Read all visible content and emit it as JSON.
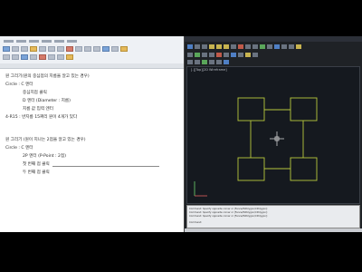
{
  "document": {
    "lines": [
      "원 그리기(원의 중심점의 지름을 알고 있는 경우)",
      "Circle : C 엔터",
      "중심지점 클릭",
      "D 엔터 (Diameter : 지름)",
      "지름 값 입력 엔터",
      "4-R15 : 반지름 15짜리 원이 4개가 있다",
      "원 그리기 (원이 지나는 2점을 알고 있는 경우)",
      "Circle : C 엔터",
      "2P 엔터 (P-Point : 2점)",
      "첫 번째 점 클릭",
      "두 번째 점 클릭"
    ]
  },
  "cad": {
    "viewport_label": "[-][Top][2D Wireframe]",
    "drawing_color": "#b8c83c",
    "crosshair_color": "#e8e8e8",
    "command_lines": [
      "Command: Specify opposite corner or [Fence/WPolygon/CPolygon]:",
      "Command: Specify opposite corner or [Fence/WPolygon/CPolygon]:",
      "Command: Specify opposite corner or [Fence/WPolygon/CPolygon]:",
      "Command:"
    ]
  }
}
